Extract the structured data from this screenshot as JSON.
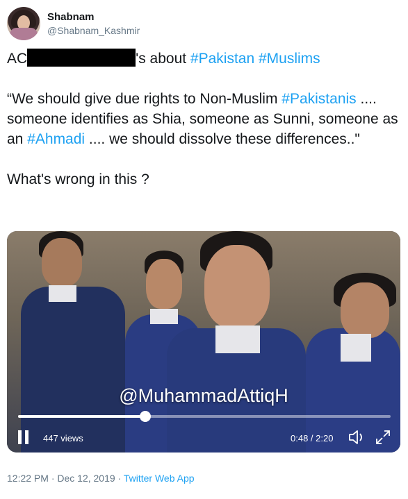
{
  "user": {
    "name": "Shabnam",
    "handle": "@Shabnam_Kashmir"
  },
  "tweet": {
    "line1_prefix": "AC",
    "line1_suffix": "'s about ",
    "hashtag_pakistan": "#Pakistan",
    "hashtag_muslims": "#Muslims",
    "quote_part1": "“We should give due rights to Non-Muslim ",
    "hashtag_pakistanis": "#Pakistanis",
    "quote_part2": " .... someone identifies as Shia, someone as Sunni, someone as an ",
    "hashtag_ahmadi": "#Ahmadi",
    "quote_part3": " .... we should dissolve these differences..\"",
    "question": "What's wrong in this ?"
  },
  "video": {
    "overlay_text": "@MuhammadAttiqH",
    "views": "447 views",
    "time": "0:48 / 2:20",
    "progress_fraction": 0.342
  },
  "meta": {
    "timestamp": "12:22 PM · Dec 12, 2019 · ",
    "source": "Twitter Web App"
  },
  "colors": {
    "link": "#1da1f2",
    "secondary_text": "#657786",
    "primary_text": "#14171a"
  }
}
